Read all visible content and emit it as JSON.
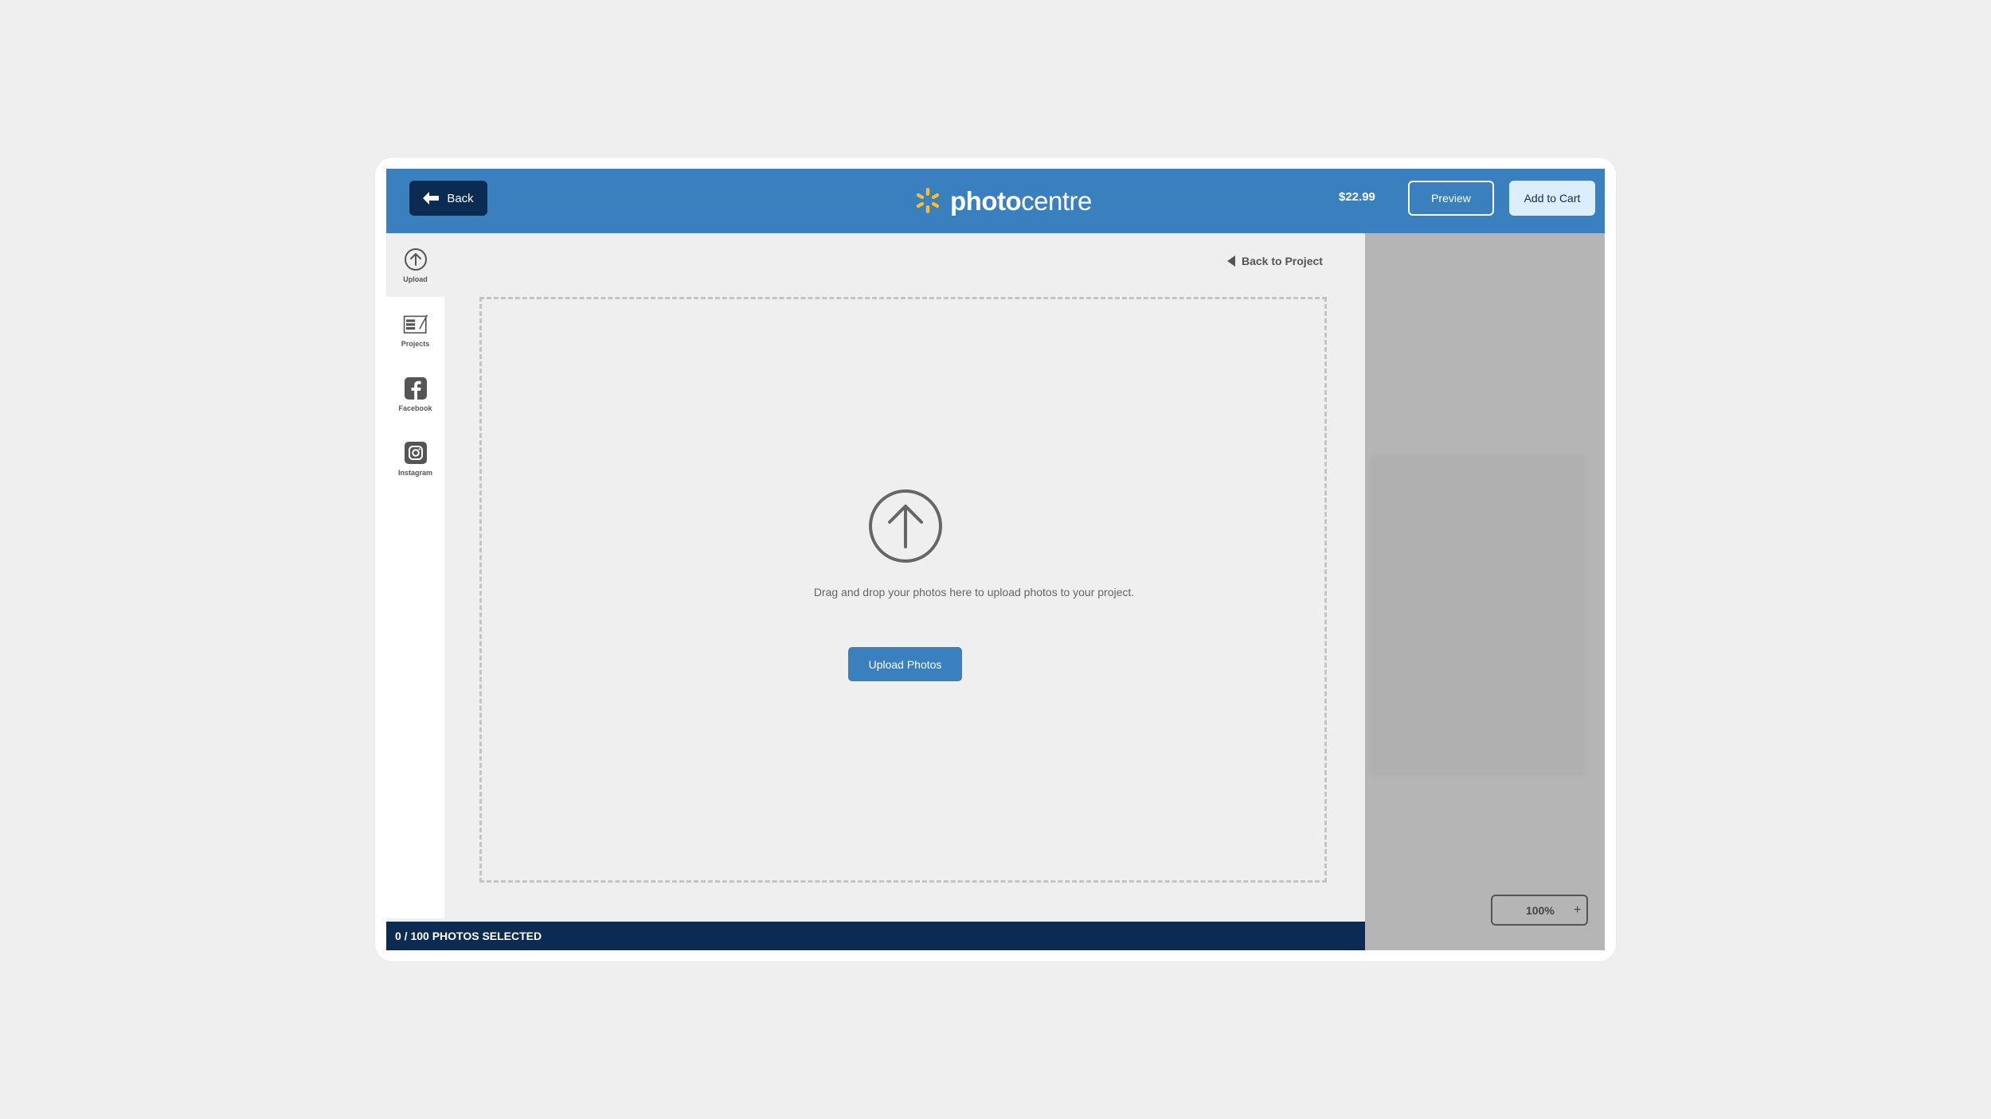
{
  "header": {
    "back_label": "Back",
    "logo_bold": "photo",
    "logo_light": "centre",
    "price": "$22.99",
    "preview_label": "Preview",
    "cart_label": "Add to Cart",
    "colors": {
      "header_bg": "#3a7fbe",
      "dark_navy": "#0c2b53",
      "logo_spark": "#f7c02b"
    }
  },
  "sidebar": {
    "items": [
      {
        "label": "Upload",
        "icon": "upload-icon",
        "active": true
      },
      {
        "label": "Projects",
        "icon": "projects-icon",
        "active": false
      },
      {
        "label": "Facebook",
        "icon": "facebook-icon",
        "active": false
      },
      {
        "label": "Instagram",
        "icon": "instagram-icon",
        "active": false
      }
    ]
  },
  "main": {
    "back_to_project": "Back to Project",
    "drop_text": "Drag and drop your photos here to upload photos to your project.",
    "upload_button": "Upload Photos"
  },
  "footer": {
    "selection_status": "0 / 100 PHOTOS SELECTED"
  },
  "right_panel": {
    "zoom_level": "100%",
    "zoom_plus": "+"
  }
}
